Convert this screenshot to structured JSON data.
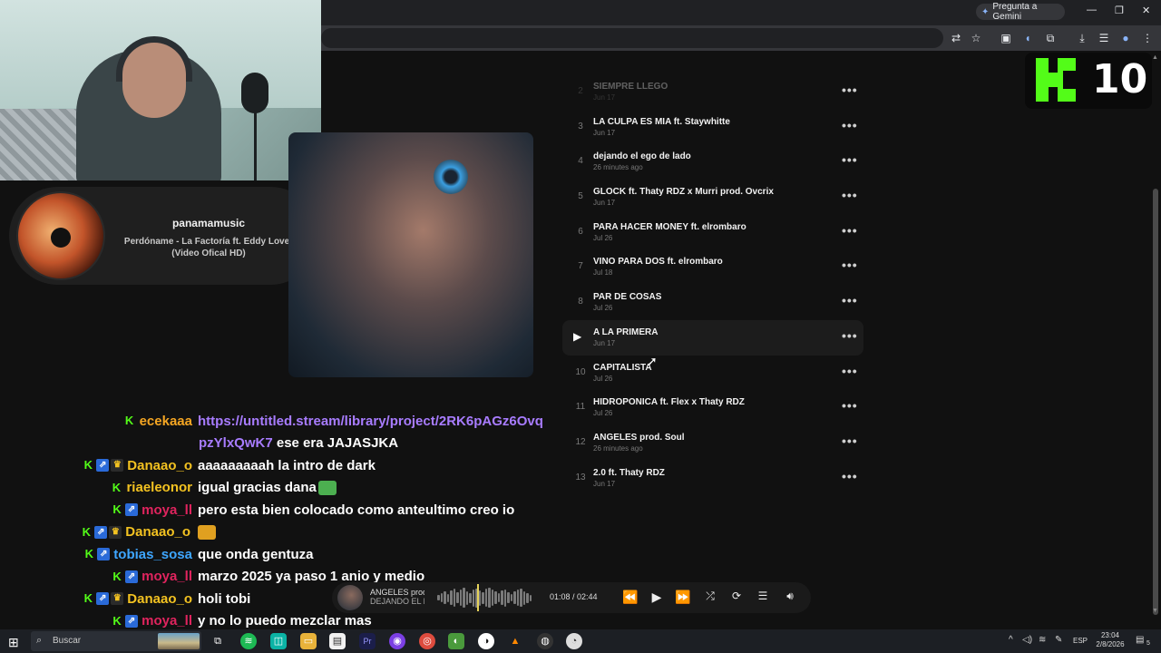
{
  "browser": {
    "gemini_label": "Pregunta a Gemini",
    "window_controls": [
      "—",
      "❐",
      "✕"
    ]
  },
  "now_playing_card": {
    "channel": "panamamusic",
    "title": "Perdóname - La Factoría ft. Eddy Lover (Video Ofical HD)"
  },
  "kick_badge": {
    "count": "10"
  },
  "tracks": [
    {
      "num": "2",
      "title": "SIEMPRE LLEGO",
      "date": "Jun 17",
      "faded": true
    },
    {
      "num": "3",
      "title": "LA CULPA ES MIA ft. Staywhitte",
      "date": "Jun 17"
    },
    {
      "num": "4",
      "title": "dejando el ego de lado",
      "date": "26 minutes ago"
    },
    {
      "num": "5",
      "title": "GLOCK ft. Thaty RDZ x Murri prod. Ovcrix",
      "date": "Jun 17"
    },
    {
      "num": "6",
      "title": "PARA HACER MONEY ft. elrombaro",
      "date": "Jul 26"
    },
    {
      "num": "7",
      "title": "VINO PARA DOS ft. elrombaro",
      "date": "Jul 18"
    },
    {
      "num": "8",
      "title": "PAR DE COSAS",
      "date": "Jul 26"
    },
    {
      "num": "",
      "title": "A LA PRIMERA",
      "date": "Jun 17",
      "active": true
    },
    {
      "num": "10",
      "title": "CAPITALISTA",
      "date": "Jul 26"
    },
    {
      "num": "11",
      "title": "HIDROPONICA ft. Flex x Thaty RDZ",
      "date": "Jul 26"
    },
    {
      "num": "12",
      "title": "ANGELES prod. Soul",
      "date": "26 minutes ago"
    },
    {
      "num": "13",
      "title": "2.0 ft. Thaty RDZ",
      "date": "Jun 17"
    }
  ],
  "more_label": "•••",
  "chat": [
    {
      "badges": [
        "k"
      ],
      "user": "ecekaaa",
      "color": "#f5a623",
      "text": "https://untitled.stream/library/project/2RK6pAGz6Ovq",
      "link": true
    },
    {
      "badges": [],
      "user": "",
      "color": "#f5a623",
      "text": "pzYlxQwK7",
      "link": true,
      "extra": " ese era JAJASJKA",
      "indent": true
    },
    {
      "badges": [
        "k",
        "v",
        "c"
      ],
      "user": "Danaao_o",
      "color": "#f3c221",
      "text": "aaaaaaaaah la intro de dark"
    },
    {
      "badges": [
        "k"
      ],
      "user": "riaeleonor",
      "color": "#f3c221",
      "text": "igual gracias dana",
      "emoji": "#4caf50"
    },
    {
      "badges": [
        "k",
        "v"
      ],
      "user": "moya_ll",
      "color": "#e0245e",
      "text": "pero esta bien colocado como anteultimo creo io"
    },
    {
      "badges": [
        "k",
        "v",
        "c"
      ],
      "user": "Danaao_o",
      "color": "#f3c221",
      "text": "",
      "emoji": "#e0a020"
    },
    {
      "badges": [
        "k",
        "v"
      ],
      "user": "tobias_sosa",
      "color": "#3ea6ff",
      "text": "que onda gentuza"
    },
    {
      "badges": [
        "k",
        "v"
      ],
      "user": "moya_ll",
      "color": "#e0245e",
      "text": "marzo 2025 ya paso 1 anio y medio"
    },
    {
      "badges": [
        "k",
        "v",
        "c"
      ],
      "user": "Danaao_o",
      "color": "#f3c221",
      "text": "holi tobi"
    },
    {
      "badges": [
        "k",
        "v"
      ],
      "user": "moya_ll",
      "color": "#e0245e",
      "text": "y no lo puedo mezclar mas"
    }
  ],
  "player": {
    "title": "ANGELES prod",
    "artist": "DEJANDO EL E",
    "time": "01:08  /  02:44",
    "progress": 0.42
  },
  "taskbar": {
    "search_placeholder": "Buscar",
    "lang": "ESP",
    "time": "23:04",
    "date": "2/8/2026",
    "notification_count": "5"
  }
}
